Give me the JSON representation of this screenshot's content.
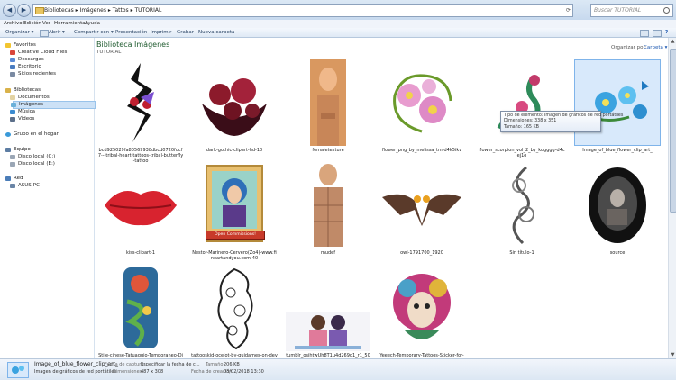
{
  "address_bar": {
    "path": "Bibliotecas  ▸  Imágenes  ▸  Tattos  ▸  TUTORIAL",
    "search_placeholder": "Buscar TUTORIAL"
  },
  "menu": [
    "Archivo",
    "Edición",
    "Ver",
    "Herramientas",
    "Ayuda"
  ],
  "toolbar": [
    "Organizar ▾",
    "Abrir ▾",
    "Compartir con ▾",
    "Presentación",
    "Imprimir",
    "Grabar",
    "Nueva carpeta"
  ],
  "nav": {
    "favorites": {
      "label": "Favoritos",
      "items": [
        "Creative Cloud Files",
        "Descargas",
        "Escritorio",
        "Sitios recientes"
      ]
    },
    "libraries": {
      "label": "Bibliotecas",
      "items": [
        "Documentos",
        "Imágenes",
        "Música",
        "Vídeos"
      ]
    },
    "homegroup": "Grupo en el hogar",
    "computer": {
      "label": "Equipo",
      "items": [
        "Disco local (C:)",
        "Disco local (E:)"
      ]
    },
    "network": {
      "label": "Red",
      "items": [
        "ASUS-PC"
      ]
    }
  },
  "content": {
    "title": "Biblioteca Imágenes",
    "subtitle": "TUTORIAL",
    "arrange_label": "Organizar por:",
    "arrange_value": "Carpeta ▾"
  },
  "files": [
    "bcd925029fa80569938dbcd0720fdcf7---tribal-heart-tattoos-tribal-butterfly-tattoo",
    "dark-gothic-clipart-hd-10",
    "femaletexture",
    "flower_png_by_melissa_tm-d4k5ikv",
    "flower_scorpion_vol_2_by_kogggg-d4cej1o",
    "Image_of_blue_flower_clip_art_",
    "kiss-clipart-1",
    "Nestor-Marinero-Cervero(Zo4)-www.fineartandyou.com-40",
    "mudef",
    "owl-1791700_1920",
    "Sin título-1",
    "source",
    "Stile-cinese-Tatuaggio-Temporaneo-Disegno-Drago",
    "tattooskid-ocelot-by-quidames-on-deviantart",
    "tumblr_osjhtwUh8T1u4d269o1_r1_500",
    "Yeeech-Temporary-Tattoos-Sticker-for-Women-"
  ],
  "thumb_overlay": "Open Commissions!",
  "tooltip": [
    "Tipo de elemento: Imagen de gráficos de red portátiles",
    "Dimensiones: 338 x 351",
    "Tamaño: 165 KB"
  ],
  "status": {
    "filename": "Image_of_blue_flower_clip_art_",
    "type": "Imagen de gráficos de red portátiles",
    "capture_key": "Fecha de captura:",
    "capture_val": "Especificar la fecha de c...",
    "dims_key": "Dimensiones:",
    "dims_val": "487 x 308",
    "size_key": "Tamaño:",
    "size_val": "206 KB",
    "created_key": "Fecha de creación:",
    "created_val": "03/02/2018 13:30"
  }
}
